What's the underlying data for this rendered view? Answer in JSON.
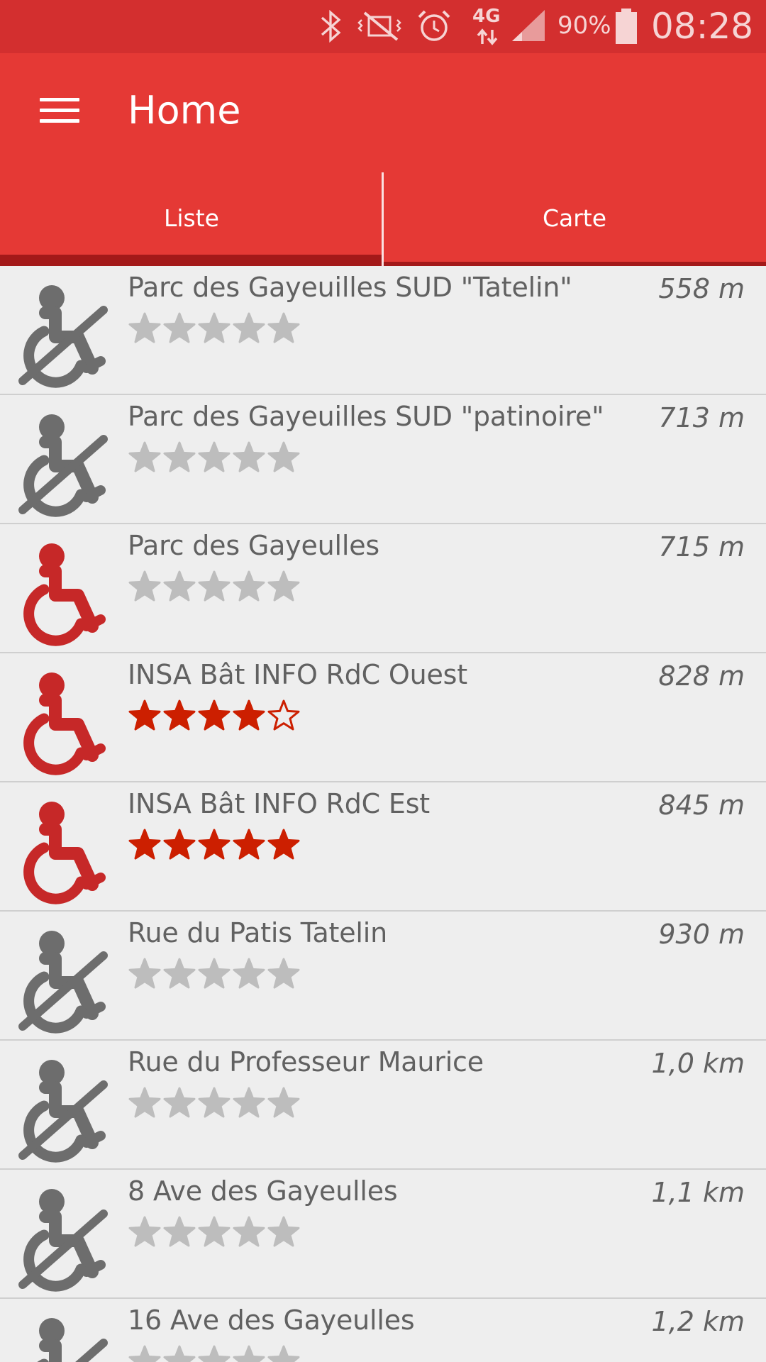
{
  "status_bar": {
    "battery_text": "90%",
    "time": "08:28",
    "network": "4G"
  },
  "toolbar": {
    "title": "Home"
  },
  "tabs": [
    {
      "label": "Liste",
      "selected": true
    },
    {
      "label": "Carte",
      "selected": false
    }
  ],
  "places": [
    {
      "name": "Parc des Gayeuilles SUD \"Tatelin\"",
      "distance": "558 m",
      "accessible": false,
      "rating": 0
    },
    {
      "name": "Parc des Gayeuilles SUD \"patinoire\"",
      "distance": "713 m",
      "accessible": false,
      "rating": 0
    },
    {
      "name": "Parc des Gayeulles",
      "distance": "715 m",
      "accessible": true,
      "rating": 0
    },
    {
      "name": "INSA Bât INFO RdC Ouest",
      "distance": "828 m",
      "accessible": true,
      "rating": 4
    },
    {
      "name": "INSA Bât INFO RdC Est",
      "distance": "845 m",
      "accessible": true,
      "rating": 5
    },
    {
      "name": "Rue du Patis Tatelin",
      "distance": "930 m",
      "accessible": false,
      "rating": 0
    },
    {
      "name": "Rue du Professeur Maurice",
      "distance": "1,0 km",
      "accessible": false,
      "rating": 0
    },
    {
      "name": "8 Ave des Gayeulles",
      "distance": "1,1 km",
      "accessible": false,
      "rating": 0
    },
    {
      "name": "16 Ave des Gayeulles",
      "distance": "1,2 km",
      "accessible": false,
      "rating": 0
    }
  ],
  "icons": {
    "menu": "hamburger-menu-icon",
    "accessible": "wheelchair-icon",
    "not_accessible": "wheelchair-crossed-icon",
    "star": "star-icon"
  },
  "colors": {
    "status_bar": "#d32f2f",
    "primary": "#e53935",
    "tab_indicator": "#a31919",
    "accessible_icon": "#c62828",
    "not_accessible_icon": "#6d6d6d",
    "star_filled": "#cc1f00",
    "star_empty": "#bdbdbd"
  }
}
